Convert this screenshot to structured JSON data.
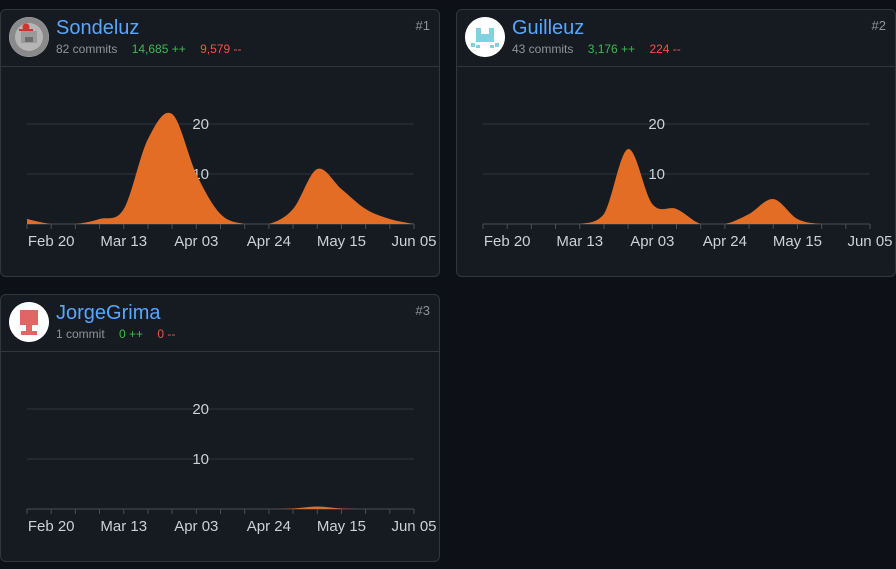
{
  "colors": {
    "background": "#0d1117",
    "card": "#161b22",
    "border": "#30363d",
    "username": "#58a6ff",
    "additions": "#3fb950",
    "deletions": "#f85149",
    "area_fill": "#e36d25",
    "grid": "#30363d"
  },
  "contributors": [
    {
      "rank": "#1",
      "username": "Sondeluz",
      "commits": "82 commits",
      "additions": "14,685 ++",
      "deletions": "9,579 --",
      "avatar_icon": "identicon-gray-red"
    },
    {
      "rank": "#2",
      "username": "Guilleuz",
      "commits": "43 commits",
      "additions": "3,176 ++",
      "deletions": "224 --",
      "avatar_icon": "identicon-light-blue"
    },
    {
      "rank": "#3",
      "username": "JorgeGrima",
      "commits": "1 commit",
      "additions": "0 ++",
      "deletions": "0 --",
      "avatar_icon": "identicon-red"
    }
  ],
  "chart_data": [
    {
      "type": "area",
      "title": "",
      "x": [
        "Feb 14",
        "Feb 20",
        "Feb 27",
        "Mar 06",
        "Mar 13",
        "Mar 20",
        "Mar 27",
        "Apr 03",
        "Apr 10",
        "Apr 17",
        "Apr 24",
        "May 01",
        "May 08",
        "May 15",
        "May 22",
        "May 29",
        "Jun 05"
      ],
      "x_ticks": [
        "Feb 20",
        "Mar 13",
        "Apr 03",
        "Apr 24",
        "May 15",
        "Jun 05"
      ],
      "y_ticks": [
        10,
        20
      ],
      "ylim": [
        0,
        23
      ],
      "values": [
        1,
        0,
        0,
        1,
        3,
        17,
        22,
        10,
        2,
        0,
        0,
        3,
        11,
        7,
        3,
        1,
        0
      ]
    },
    {
      "type": "area",
      "title": "",
      "x": [
        "Feb 14",
        "Feb 20",
        "Feb 27",
        "Mar 06",
        "Mar 13",
        "Mar 20",
        "Mar 27",
        "Apr 03",
        "Apr 10",
        "Apr 17",
        "Apr 24",
        "May 01",
        "May 08",
        "May 15",
        "May 22",
        "May 29",
        "Jun 05"
      ],
      "x_ticks": [
        "Feb 20",
        "Mar 13",
        "Apr 03",
        "Apr 24",
        "May 15",
        "Jun 05"
      ],
      "y_ticks": [
        10,
        20
      ],
      "ylim": [
        0,
        23
      ],
      "values": [
        0,
        0,
        0,
        0,
        0,
        2,
        15,
        4,
        3,
        0,
        0,
        2,
        5,
        1,
        0,
        0,
        0
      ]
    },
    {
      "type": "area",
      "title": "",
      "x": [
        "Feb 14",
        "Feb 20",
        "Feb 27",
        "Mar 06",
        "Mar 13",
        "Mar 20",
        "Mar 27",
        "Apr 03",
        "Apr 10",
        "Apr 17",
        "Apr 24",
        "May 01",
        "May 08",
        "May 15",
        "May 22",
        "May 29",
        "Jun 05"
      ],
      "x_ticks": [
        "Feb 20",
        "Mar 13",
        "Apr 03",
        "Apr 24",
        "May 15",
        "Jun 05"
      ],
      "y_ticks": [
        10,
        20
      ],
      "ylim": [
        0,
        23
      ],
      "values": [
        0,
        0,
        0,
        0,
        0,
        0,
        0,
        0,
        0,
        0,
        0,
        0.1,
        0.5,
        0.1,
        0,
        0,
        0
      ]
    }
  ]
}
